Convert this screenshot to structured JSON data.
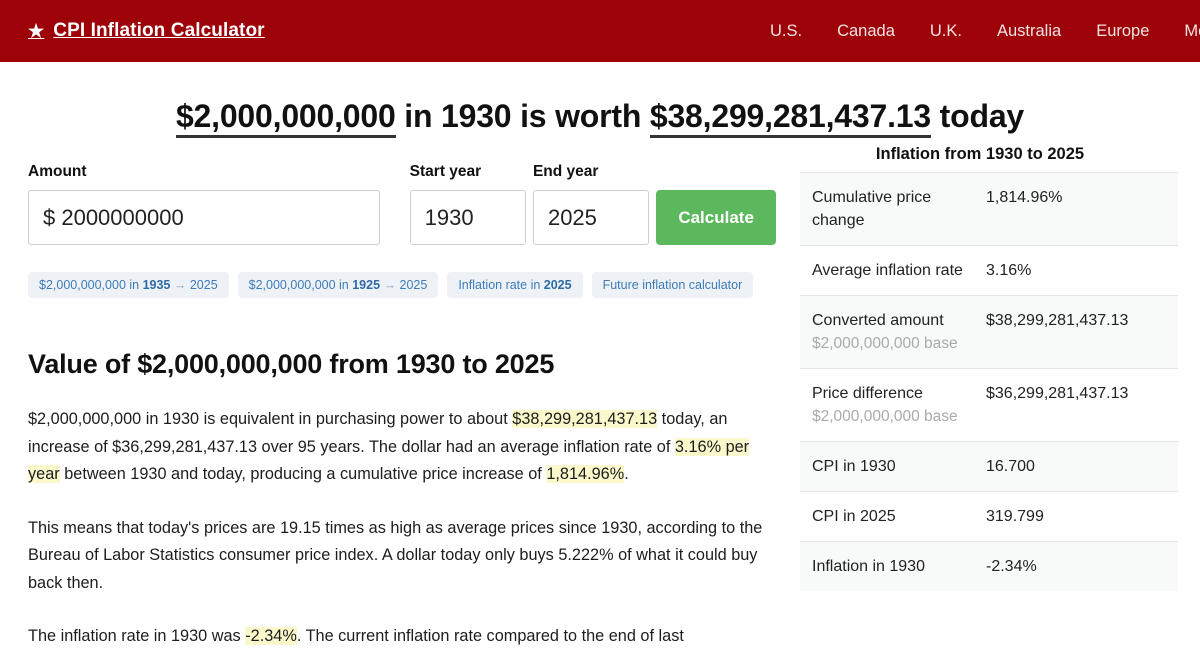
{
  "header": {
    "brand": {
      "icon": "star-icon",
      "glyph": "★",
      "label": "CPI Inflation Calculator"
    },
    "nav": [
      {
        "label": "U.S."
      },
      {
        "label": "Canada"
      },
      {
        "label": "U.K."
      },
      {
        "label": "Australia"
      },
      {
        "label": "Europe"
      },
      {
        "label": "More"
      }
    ],
    "bg_color": "#9d0208"
  },
  "headline": {
    "amount": "$2,000,000,000",
    "mid": " in 1930 is worth ",
    "converted": "$38,299,281,437.13",
    "suffix": " today"
  },
  "form": {
    "amount_label": "Amount",
    "amount_value": "$ 2000000000",
    "start_label": "Start year",
    "start_value": "1930",
    "end_label": "End year",
    "end_value": "2025",
    "calculate_label": "Calculate",
    "calculate_color": "#5cb85c"
  },
  "chips": [
    {
      "pre": "$2,000,000,000 in ",
      "bold": "1935",
      "arrow": " → ",
      "post": "2025"
    },
    {
      "pre": "$2,000,000,000 in ",
      "bold": "1925",
      "arrow": " → ",
      "post": "2025"
    },
    {
      "pre": "Inflation rate in ",
      "bold": "2025",
      "arrow": "",
      "post": ""
    },
    {
      "pre": "Future inflation calculator",
      "bold": "",
      "arrow": "",
      "post": ""
    }
  ],
  "article": {
    "title": "Value of $2,000,000,000 from 1930 to 2025",
    "p1_a": "$2,000,000,000 in 1930 is equivalent in purchasing power to about ",
    "p1_hl1": "$38,299,281,437.13",
    "p1_b": " today, an increase of $36,299,281,437.13 over 95 years. The dollar had an average inflation rate of ",
    "p1_hl2": "3.16% per year",
    "p1_c": " between 1930 and today, producing a cumulative price increase of ",
    "p1_hl3": "1,814.96%",
    "p1_d": ".",
    "p2": "This means that today's prices are 19.15 times as high as average prices since 1930, according to the Bureau of Labor Statistics consumer price index. A dollar today only buys 5.222% of what it could buy back then.",
    "p3_a": "The inflation rate in 1930 was ",
    "p3_hl": "-2.34%",
    "p3_b": ". The current inflation rate compared to the end of last"
  },
  "table": {
    "title": "Inflation from 1930 to 2025",
    "rows": [
      {
        "label": "Cumulative price change",
        "sub": "",
        "value": "1,814.96%",
        "striped": true
      },
      {
        "label": "Average inflation rate",
        "sub": "",
        "value": "3.16%",
        "striped": false
      },
      {
        "label": "Converted amount",
        "sub": "$2,000,000,000 base",
        "value": "$38,299,281,437.13",
        "striped": true
      },
      {
        "label": "Price difference",
        "sub": "$2,000,000,000 base",
        "value": "$36,299,281,437.13",
        "striped": false
      },
      {
        "label": "CPI in 1930",
        "sub": "",
        "value": "16.700",
        "striped": true
      },
      {
        "label": "CPI in 2025",
        "sub": "",
        "value": "319.799",
        "striped": false
      },
      {
        "label": "Inflation in 1930",
        "sub": "",
        "value": "-2.34%",
        "striped": true
      }
    ]
  }
}
